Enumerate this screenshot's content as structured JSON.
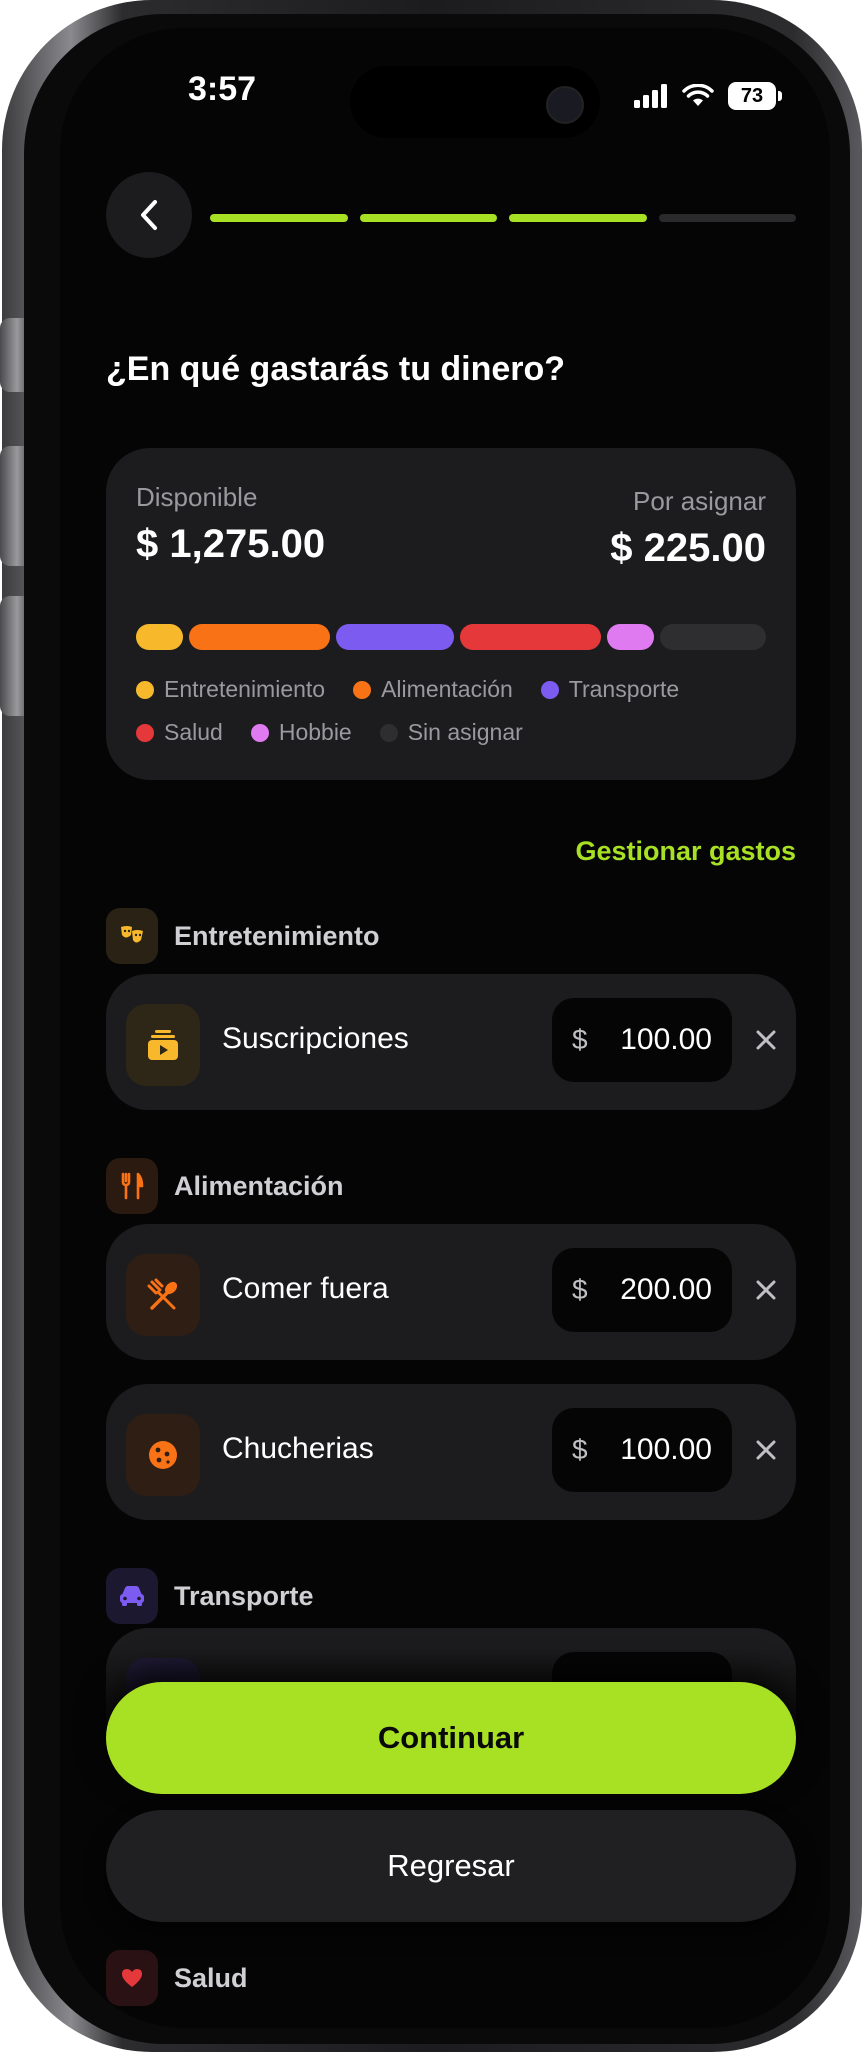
{
  "status_bar": {
    "time": "3:57",
    "battery": "73"
  },
  "header": {
    "title": "¿En qué gastarás tu dinero?",
    "progress_steps_total": 4,
    "progress_steps_done": 3
  },
  "budget": {
    "available_label": "Disponible",
    "available_amount": "$ 1,275.00",
    "unassigned_label": "Por asignar",
    "unassigned_amount": "$ 225.00",
    "segments": [
      {
        "name": "Entretenimiento",
        "value": 100,
        "color": "#f7b92b"
      },
      {
        "name": "Alimentación",
        "value": 300,
        "color": "#f97316"
      },
      {
        "name": "Transporte",
        "value": 250,
        "color": "#7c5cf0"
      },
      {
        "name": "Salud",
        "value": 300,
        "color": "#e5383b"
      },
      {
        "name": "Hobbie",
        "value": 100,
        "color": "#e07af0"
      },
      {
        "name": "Sin asignar",
        "value": 225,
        "color": "#2e2e30"
      }
    ],
    "legend": [
      {
        "label": "Entretenimiento",
        "color": "#f7b92b"
      },
      {
        "label": "Alimentación",
        "color": "#f97316"
      },
      {
        "label": "Transporte",
        "color": "#7c5cf0"
      },
      {
        "label": "Salud",
        "color": "#e5383b"
      },
      {
        "label": "Hobbie",
        "color": "#e07af0"
      },
      {
        "label": "Sin asignar",
        "color": "#2e2e30"
      }
    ]
  },
  "manage_link": "Gestionar gastos",
  "categories": [
    {
      "name": "Entretenimiento",
      "icon": "theater-masks-icon",
      "color": "#f7b92b",
      "items": [
        {
          "name": "Suscripciones",
          "icon": "subscription-icon",
          "currency": "$",
          "amount": "100.00"
        }
      ]
    },
    {
      "name": "Alimentación",
      "icon": "fork-knife-icon",
      "color": "#f97316",
      "items": [
        {
          "name": "Comer fuera",
          "icon": "spoon-fork-icon",
          "currency": "$",
          "amount": "200.00"
        },
        {
          "name": "Chucherias",
          "icon": "cookie-icon",
          "currency": "$",
          "amount": "100.00"
        }
      ]
    },
    {
      "name": "Transporte",
      "icon": "car-icon",
      "color": "#7c5cf0",
      "items": []
    },
    {
      "name": "Salud",
      "icon": "health-icon",
      "color": "#e5383b",
      "items": []
    }
  ],
  "actions": {
    "continue_label": "Continuar",
    "back_label": "Regresar"
  },
  "colors": {
    "accent": "#a8e023",
    "card": "#1c1c1e",
    "background": "#050505"
  }
}
